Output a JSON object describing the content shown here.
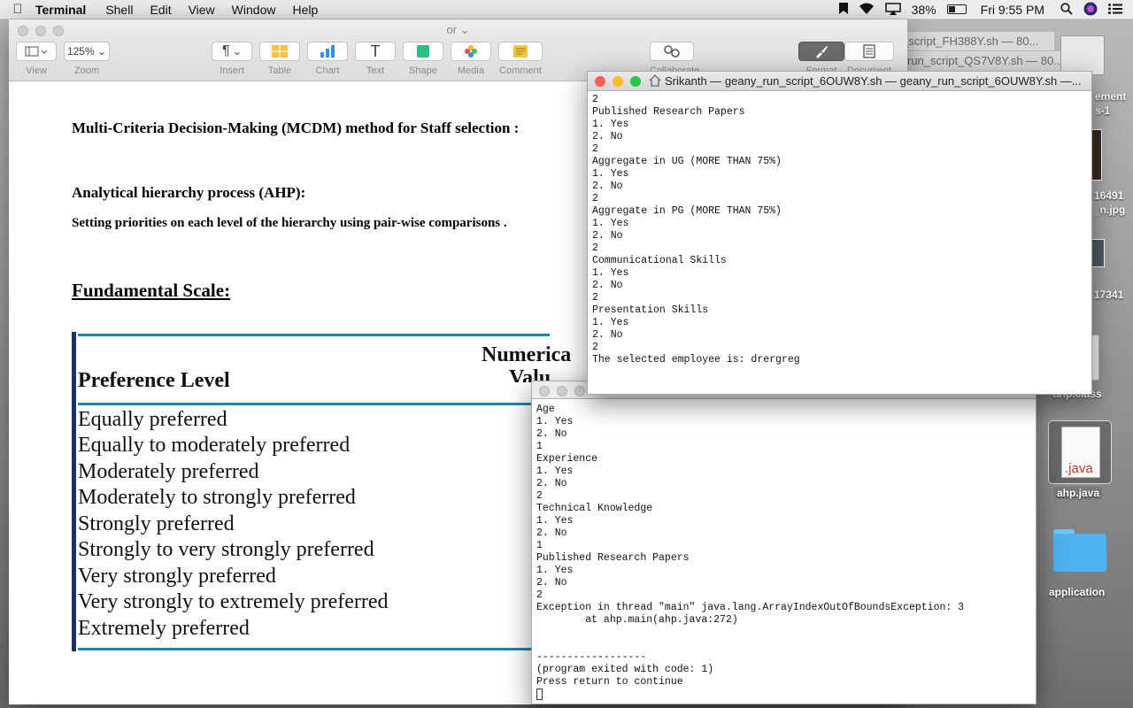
{
  "menubar": {
    "app": "Terminal",
    "items": [
      "Shell",
      "Edit",
      "View",
      "Window",
      "Help"
    ],
    "battery": "38%",
    "clock": "Fri 9:55 PM"
  },
  "pages": {
    "title": "or",
    "toolbar": {
      "view_label": "View",
      "zoom_value": "125%",
      "zoom_label": "Zoom",
      "insert": "Insert",
      "table": "Table",
      "chart": "Chart",
      "text": "Text",
      "shape": "Shape",
      "media": "Media",
      "comment": "Comment",
      "collaborate": "Collaborate",
      "format": "Format",
      "document": "Document"
    },
    "doc": {
      "heading1": "Multi-Criteria Decision-Making (MCDM) method for Staff selection :",
      "heading2": "Analytical hierarchy process (AHP):",
      "para": "Setting priorities on each level of the hierarchy using pair-wise comparisons .",
      "scale_title": "Fundamental Scale:",
      "table_header_pref": "Preference Level",
      "table_header_num_1": "Numerica",
      "table_header_num_2": "Valu",
      "rows": [
        "Equally preferred",
        "Equally to moderately preferred",
        "Moderately preferred",
        "Moderately to strongly preferred",
        "Strongly preferred",
        "Strongly to very strongly preferred",
        "Very strongly preferred",
        "Very strongly to extremely preferred",
        "Extremely preferred"
      ]
    }
  },
  "bg_windows": {
    "tab1": "_script_FH388Y.sh — 80...",
    "tab2": "run_script_QS7V8Y.sh — 80..."
  },
  "term1": {
    "title": "Srikanth — geany_run_script_6OUW8Y.sh — geany_run_script_6OUW8Y.sh —...",
    "lines": [
      "2",
      "Published Research Papers",
      "1. Yes",
      "2. No",
      "2",
      "Aggregate in UG (MORE THAN 75%)",
      "1. Yes",
      "2. No",
      "2",
      "Aggregate in PG (MORE THAN 75%)",
      "1. Yes",
      "2. No",
      "2",
      "Communicational Skills",
      "1. Yes",
      "2. No",
      "2",
      "Presentation Skills",
      "1. Yes",
      "2. No",
      "2",
      "The selected employee is: drergreg"
    ]
  },
  "term2": {
    "lines": [
      "Age",
      "1. Yes",
      "2. No",
      "1",
      "Experience",
      "1. Yes",
      "2. No",
      "2",
      "Technical Knowledge",
      "1. Yes",
      "2. No",
      "1",
      "Published Research Papers",
      "1. Yes",
      "2. No",
      "2",
      "Exception in thread \"main\" java.lang.ArrayIndexOutOfBoundsException: 3",
      "        at ahp.main(ahp.java:272)",
      "",
      "",
      "------------------",
      "(program exited with code: 1)",
      "Press return to continue"
    ]
  },
  "desktop": {
    "label_1": "ement",
    "label_2": "s-1",
    "label_3": "16491",
    "label_4": "_n.jpg",
    "label_5": "17341",
    "label_6": "ahp.class",
    "java_badge": ".java",
    "java_file": "ahp.java",
    "folder": "application"
  },
  "colors": {
    "close": "#fc5f57",
    "minimize": "#fdbc2e",
    "zoom": "#28c840",
    "table_rule": "#1a86b4",
    "table_bar": "#1a2f6b",
    "folder": "#4fb3ef"
  }
}
